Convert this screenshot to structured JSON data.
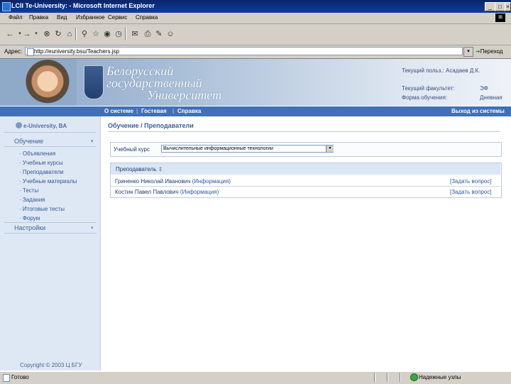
{
  "window": {
    "title": "LCII Te-University: - Microsoft Internet Explorer",
    "buttons": [
      "_",
      "Ɓ",
      "×"
    ]
  },
  "menu": [
    "Файл",
    "Правка",
    "Вид",
    "Избранное",
    "Сервис",
    "Справка"
  ],
  "address": {
    "label": "Адрес:",
    "url": "http://euniversity.bsu/Teachers.jsp",
    "go": "Переход"
  },
  "banner": {
    "line1": "Белорусский",
    "line2": "государственный",
    "line3": "Университет",
    "user": "Текущий польз.: Асадаев Д.К.",
    "faculty_label": "Текущий факультет:",
    "faculty_value": "ЭФ",
    "form_label": "Форма обучения:",
    "form_value": "Дневная"
  },
  "nav": {
    "items": [
      "О системе",
      "Гостевая",
      "Справка"
    ],
    "exit": "Выход из системы"
  },
  "sidebar": {
    "logo": "e-University, BA",
    "section1": "Обучение",
    "items": [
      "Объявления",
      "Учебные курсы",
      "Преподаватели",
      "Учебные материалы",
      "Тесты",
      "Задания",
      "Итоговые тесты",
      "Форум"
    ],
    "section2": "Настройки",
    "copyright": "Copyright © 2003 Ц БГУ"
  },
  "main": {
    "title": "Обучение / Преподаватели",
    "course_label": "Учебный курс",
    "course_value": "Вычислительные информационные технологии",
    "table_header": "Преподаватель",
    "rows": [
      {
        "name": "Гриненко Николай Иванович",
        "info": "(Информация)",
        "action": "[Задать вопрос]"
      },
      {
        "name": "Костин Павел Павлович",
        "info": "(Информация)",
        "action": "[Задать вопрос]"
      }
    ]
  },
  "status": {
    "text": "Готово",
    "zone": "Надежные узлы"
  },
  "colors": {
    "titlebar": "#0a246a",
    "navbar": "#3f70b8",
    "sidebar": "#dee8f5",
    "link": "#2d56a8"
  }
}
